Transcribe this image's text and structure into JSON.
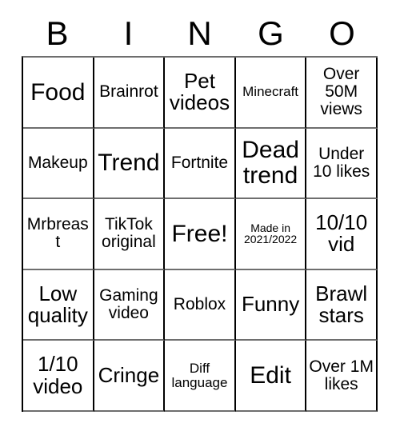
{
  "card": {
    "header_letters": [
      "B",
      "I",
      "N",
      "G",
      "O"
    ],
    "columns": 5,
    "rows": 5,
    "border_color": "#000000",
    "background_color": "#ffffff",
    "text_color": "#000000",
    "cells": [
      {
        "text": "Food",
        "size": "xl"
      },
      {
        "text": "Brainrot",
        "size": "md"
      },
      {
        "text": "Pet videos",
        "size": "lg"
      },
      {
        "text": "Minecraft",
        "size": "sm"
      },
      {
        "text": "Over 50M views",
        "size": "md"
      },
      {
        "text": "Makeup",
        "size": "md"
      },
      {
        "text": "Trend",
        "size": "xl"
      },
      {
        "text": "Fortnite",
        "size": "md"
      },
      {
        "text": "Dead trend",
        "size": "xl"
      },
      {
        "text": "Under 10 likes",
        "size": "md"
      },
      {
        "text": "Mrbreast",
        "size": "md"
      },
      {
        "text": "TikTok original",
        "size": "md"
      },
      {
        "text": "Free!",
        "size": "xl"
      },
      {
        "text": "Made in 2021/2022",
        "size": "xs"
      },
      {
        "text": "10/10 vid",
        "size": "lg"
      },
      {
        "text": "Low quality",
        "size": "lg"
      },
      {
        "text": "Gaming video",
        "size": "md"
      },
      {
        "text": "Roblox",
        "size": "md"
      },
      {
        "text": "Funny",
        "size": "lg"
      },
      {
        "text": "Brawl stars",
        "size": "lg"
      },
      {
        "text": "1/10 video",
        "size": "lg"
      },
      {
        "text": "Cringe",
        "size": "lg"
      },
      {
        "text": "Diff language",
        "size": "sm"
      },
      {
        "text": "Edit",
        "size": "xl"
      },
      {
        "text": "Over 1M likes",
        "size": "md"
      }
    ]
  }
}
